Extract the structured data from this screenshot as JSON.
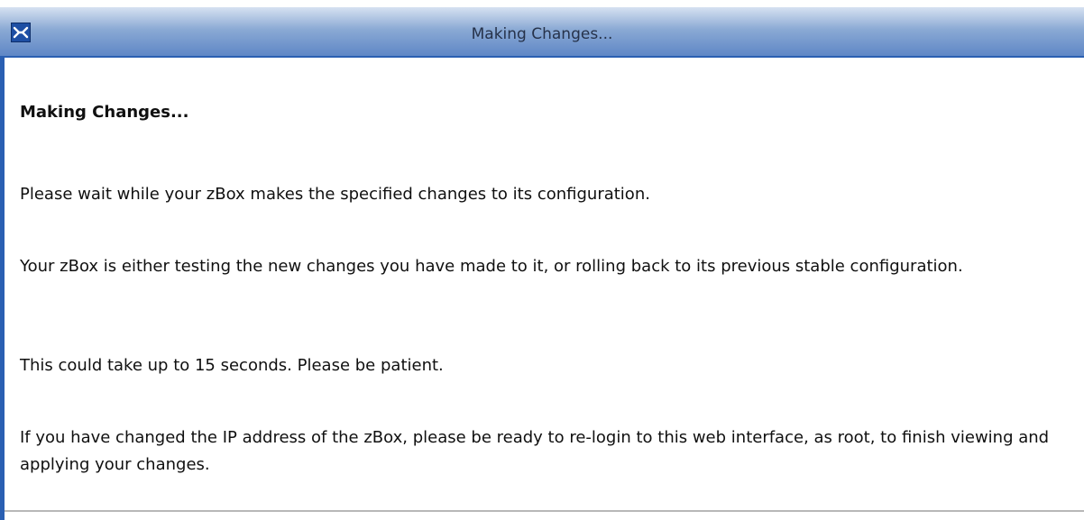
{
  "window": {
    "title": "Making Changes...",
    "icon": "zbox-logo-icon"
  },
  "content": {
    "heading": "Making Changes...",
    "paragraphs": [
      "Please wait while your zBox makes the specified changes to its configuration.",
      "Your zBox is either testing the new changes you have made to it, or rolling back to its previous stable configuration.",
      "This could take up to 15 seconds. Please be patient.",
      "If you have changed the IP address of the zBox, please be ready to re-login to this web interface, as root, to finish viewing and applying your changes."
    ]
  },
  "colors": {
    "titlebar_top": "#d6e1f1",
    "titlebar_bottom": "#5f87c6",
    "accent_border": "#2a5fb2",
    "text": "#101010"
  }
}
